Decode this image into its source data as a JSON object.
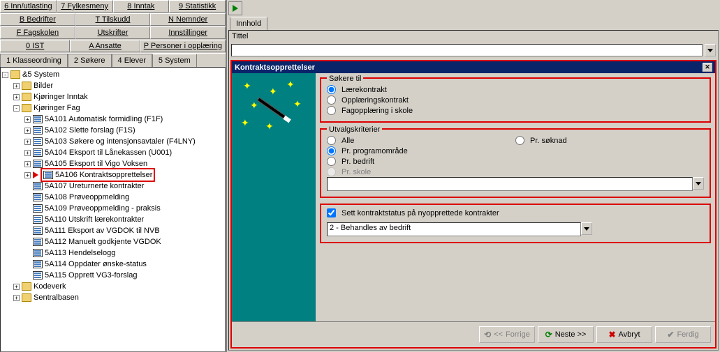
{
  "menu": {
    "rows": [
      [
        "6 Inn/utlasting",
        "7 Fylkesmeny",
        "8 Inntak",
        "9 Statistikk"
      ],
      [
        "B Bedrifter",
        "T Tilskudd",
        "N Nemnder"
      ],
      [
        "F Fagskolen",
        "Utskrifter",
        "Innstillinger"
      ],
      [
        "0 IST",
        "A Ansatte",
        "P Personer i opplæring"
      ]
    ]
  },
  "tabs_left": [
    "1 Klasseordning",
    "2 Søkere",
    "4 Elever",
    "5 System"
  ],
  "tree": {
    "root": "&5 System",
    "nodes": [
      {
        "indent": 1,
        "expander": "+",
        "icon": "folder",
        "label": "Bilder"
      },
      {
        "indent": 1,
        "expander": "+",
        "icon": "folder",
        "label": "Kjøringer Inntak"
      },
      {
        "indent": 1,
        "expander": "-",
        "icon": "folder",
        "label": "Kjøringer Fag"
      },
      {
        "indent": 2,
        "expander": "+",
        "icon": "db",
        "label": "5A101 Automatisk formidling (F1F)"
      },
      {
        "indent": 2,
        "expander": "+",
        "icon": "db",
        "label": "5A102 Slette forslag (F1S)"
      },
      {
        "indent": 2,
        "expander": "+",
        "icon": "db",
        "label": "5A103 Søkere og intensjonsavtaler (F4LNY)"
      },
      {
        "indent": 2,
        "expander": "+",
        "icon": "db",
        "label": "5A104 Eksport til Lånekassen (U001)"
      },
      {
        "indent": 2,
        "expander": "+",
        "icon": "db",
        "label": "5A105 Eksport til Vigo Voksen"
      },
      {
        "indent": 2,
        "expander": "+",
        "icon": "db",
        "label": "5A106 Kontraktsopprettelser",
        "highlight": true,
        "arrow": true
      },
      {
        "indent": 2,
        "expander": "",
        "icon": "db",
        "label": "5A107 Ureturnerte kontrakter"
      },
      {
        "indent": 2,
        "expander": "",
        "icon": "db",
        "label": "5A108 Prøveoppmelding"
      },
      {
        "indent": 2,
        "expander": "",
        "icon": "db",
        "label": "5A109 Prøveoppmelding - praksis"
      },
      {
        "indent": 2,
        "expander": "",
        "icon": "db",
        "label": "5A110 Utskrift lærekontrakter"
      },
      {
        "indent": 2,
        "expander": "",
        "icon": "db",
        "label": "5A111 Eksport av VGDOK til NVB"
      },
      {
        "indent": 2,
        "expander": "",
        "icon": "db",
        "label": "5A112 Manuelt godkjente VGDOK"
      },
      {
        "indent": 2,
        "expander": "",
        "icon": "db",
        "label": "5A113 Hendelselogg"
      },
      {
        "indent": 2,
        "expander": "",
        "icon": "db",
        "label": "5A114 Oppdater ønske-status"
      },
      {
        "indent": 2,
        "expander": "",
        "icon": "db",
        "label": "5A115 Opprett VG3-forslag"
      },
      {
        "indent": 1,
        "expander": "+",
        "icon": "folder",
        "label": "Kodeverk"
      },
      {
        "indent": 1,
        "expander": "+",
        "icon": "folder",
        "label": "Sentralbasen"
      }
    ]
  },
  "right_tab": "Innhold",
  "tittel_label": "Tittel",
  "wizard": {
    "title": "Kontraktsopprettelser",
    "g1": {
      "legend": "Søkere til",
      "o1": "Lærekontrakt",
      "o2": "Opplæringskontrakt",
      "o3": "Fagopplæring i skole"
    },
    "g2": {
      "legend": "Utvalgskriterier",
      "a1": "Alle",
      "a2": "Pr. søknad",
      "b1": "Pr. programområde",
      "c1": "Pr. bedrift",
      "d1": "Pr. skole",
      "combo_value": ""
    },
    "g3": {
      "check": "Sett kontraktstatus på nyopprettede kontrakter",
      "combo_value": "2     -     Behandles av bedrift"
    },
    "buttons": {
      "prev": "Forrige",
      "next": "Neste >>",
      "cancel": "Avbryt",
      "finish": "Ferdig"
    }
  }
}
